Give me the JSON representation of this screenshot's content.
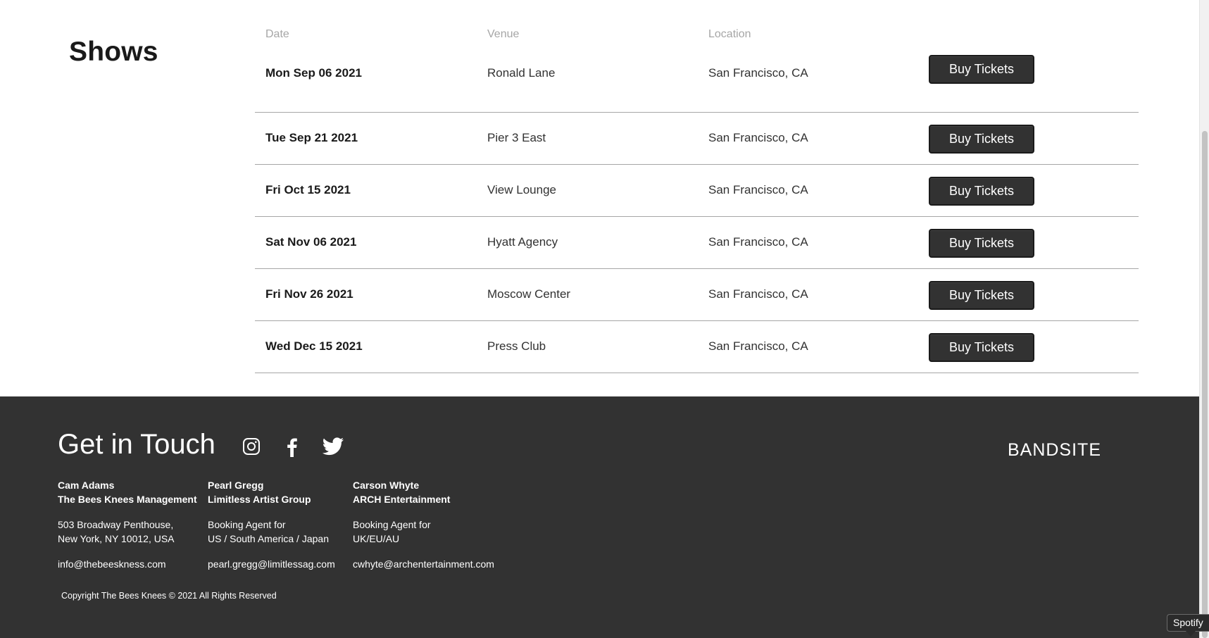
{
  "shows": {
    "title": "Shows",
    "headers": {
      "date": "Date",
      "venue": "Venue",
      "location": "Location"
    },
    "rows": [
      {
        "date": "Mon Sep 06 2021",
        "venue": "Ronald Lane",
        "location": "San Francisco, CA",
        "button": "Buy Tickets"
      },
      {
        "date": "Tue Sep 21 2021",
        "venue": "Pier 3 East",
        "location": "San Francisco, CA",
        "button": "Buy Tickets"
      },
      {
        "date": "Fri Oct 15 2021",
        "venue": "View Lounge",
        "location": "San Francisco, CA",
        "button": "Buy Tickets"
      },
      {
        "date": "Sat Nov 06 2021",
        "venue": "Hyatt Agency",
        "location": "San Francisco, CA",
        "button": "Buy Tickets"
      },
      {
        "date": "Fri Nov 26 2021",
        "venue": "Moscow Center",
        "location": "San Francisco, CA",
        "button": "Buy Tickets"
      },
      {
        "date": "Wed Dec 15 2021",
        "venue": "Press Club",
        "location": "San Francisco, CA",
        "button": "Buy Tickets"
      }
    ]
  },
  "footer": {
    "title": "Get in Touch",
    "social_icons": [
      "instagram-icon",
      "facebook-icon",
      "twitter-icon"
    ],
    "brand": "BANDSITE",
    "contacts": [
      {
        "name": "Cam Adams",
        "org": "The Bees Knees Management",
        "line1": "503 Broadway Penthouse,",
        "line2": "New York, NY 10012, USA",
        "email": "info@thebeeskness.com"
      },
      {
        "name": "Pearl Gregg",
        "org": "Limitless Artist Group",
        "line1": "Booking Agent for",
        "line2": "US / South America / Japan",
        "email": "pearl.gregg@limitlessag.com"
      },
      {
        "name": "Carson Whyte",
        "org": "ARCH Entertainment",
        "line1": "Booking Agent for",
        "line2": "UK/EU/AU",
        "email": "cwhyte@archentertainment.com"
      }
    ],
    "copyright": "Copyright The Bees Knees © 2021 All Rights Reserved"
  },
  "tooltip": {
    "text": "Spotify"
  },
  "colors": {
    "footer_bg": "#323232",
    "button_bg": "#323232",
    "divider": "#a6a6a6",
    "header_text": "#a6a6a6"
  }
}
